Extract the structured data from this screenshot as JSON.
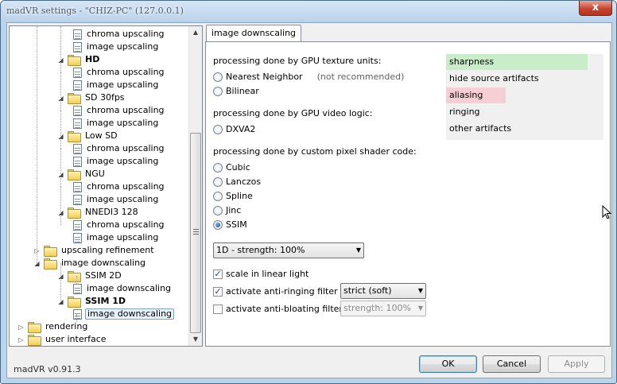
{
  "window": {
    "title": "madVR settings - \"CHIZ-PC\" (127.0.0.1)",
    "close_label": "x"
  },
  "tree": {
    "items": [
      {
        "label": "chroma upscaling",
        "type": "doc"
      },
      {
        "label": "image upscaling",
        "type": "doc"
      },
      {
        "label": "HD",
        "type": "folder",
        "bold": true,
        "expander": "◢"
      },
      {
        "label": "chroma upscaling",
        "type": "doc"
      },
      {
        "label": "image upscaling",
        "type": "doc"
      },
      {
        "label": "SD 30fps",
        "type": "folder",
        "expander": "◢"
      },
      {
        "label": "chroma upscaling",
        "type": "doc"
      },
      {
        "label": "image upscaling",
        "type": "doc"
      },
      {
        "label": "Low SD",
        "type": "folder",
        "expander": "◢"
      },
      {
        "label": "chroma upscaling",
        "type": "doc"
      },
      {
        "label": "image upscaling",
        "type": "doc"
      },
      {
        "label": "NGU",
        "type": "folder",
        "expander": "◢"
      },
      {
        "label": "chroma upscaling",
        "type": "doc"
      },
      {
        "label": "image upscaling",
        "type": "doc"
      },
      {
        "label": "NNEDI3 128",
        "type": "folder",
        "expander": "◢"
      },
      {
        "label": "chroma upscaling",
        "type": "doc"
      },
      {
        "label": "image upscaling",
        "type": "doc"
      },
      {
        "label": "upscaling refinement",
        "type": "folder",
        "expander": "▷"
      },
      {
        "label": "image downscaling",
        "type": "folder",
        "expander": "◢"
      },
      {
        "label": "SSIM 2D",
        "type": "folder",
        "expander": "◢"
      },
      {
        "label": "image downscaling",
        "type": "doc"
      },
      {
        "label": "SSIM 1D",
        "type": "folder",
        "bold": true,
        "expander": "◢"
      },
      {
        "label": "image downscaling",
        "type": "doc",
        "selected": true
      },
      {
        "label": "rendering",
        "type": "folder",
        "expander": "▷"
      },
      {
        "label": "user interface",
        "type": "folder",
        "expander": "▷"
      }
    ]
  },
  "tab": {
    "label": "image downscaling"
  },
  "panel": {
    "gpu_texture_label": "processing done by GPU texture units:",
    "nearest_neighbor": "Nearest Neighbor",
    "not_recommended": "(not recommended)",
    "bilinear": "Bilinear",
    "gpu_video_label": "processing done by GPU video logic:",
    "dxva2": "DXVA2",
    "shader_label": "processing done by custom pixel shader code:",
    "cubic": "Cubic",
    "lanczos": "Lanczos",
    "spline": "Spline",
    "jinc": "Jinc",
    "ssim": "SSIM",
    "selected_filter": "SSIM",
    "strength_combo": "1D - strength: 100%",
    "scale_linear_light": "scale in linear light",
    "scale_linear_light_checked": true,
    "anti_ringing": "activate anti-ringing filter",
    "anti_ringing_checked": true,
    "anti_ringing_combo": "strict (soft)",
    "anti_bloating": "activate anti-bloating filter",
    "anti_bloating_checked": false,
    "anti_bloating_combo": "strength: 100%"
  },
  "legend": {
    "rows": [
      {
        "label": "sharpness",
        "level": 0.9,
        "color": "#c9ecc9"
      },
      {
        "label": "hide source artifacts",
        "level": 0.0,
        "color": "#f0f0f0"
      },
      {
        "label": "aliasing",
        "level": 0.38,
        "color": "#f5cfd3"
      },
      {
        "label": "ringing",
        "level": 0.0,
        "color": "#f0f0f0"
      },
      {
        "label": "other artifacts",
        "level": 0.0,
        "color": "#f0f0f0"
      }
    ]
  },
  "footer": {
    "version": "madVR v0.91.3",
    "ok": "OK",
    "cancel": "Cancel",
    "apply": "Apply"
  },
  "colors": {
    "selection_border": "#7da2ce",
    "default_button_border": "#3c7fb1"
  }
}
